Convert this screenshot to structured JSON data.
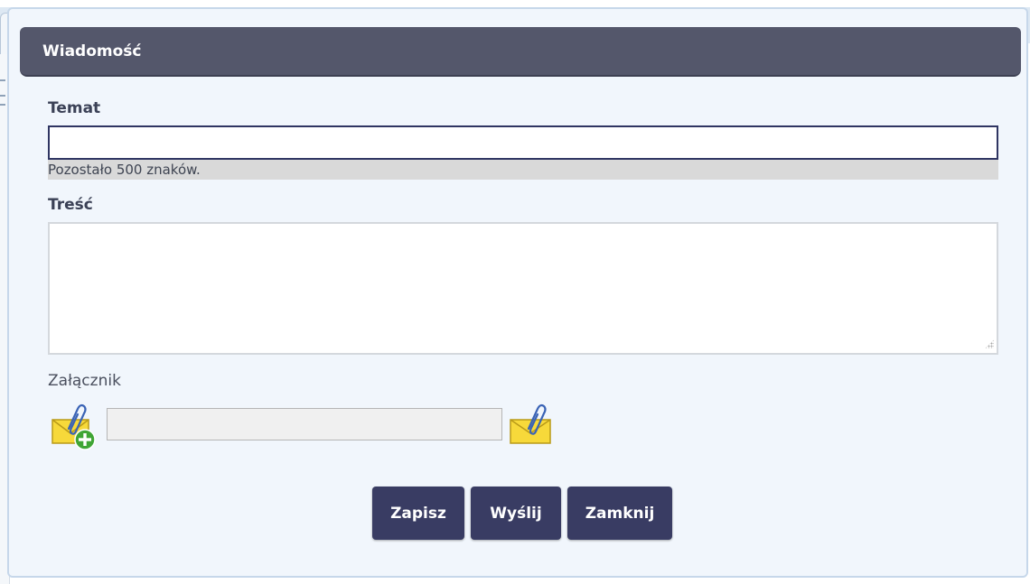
{
  "dialog": {
    "title": "Wiadomość"
  },
  "form": {
    "subject_label": "Temat",
    "subject_value": "",
    "remaining_text": "Pozostało 500 znaków.",
    "content_label": "Treść",
    "content_value": "",
    "attachment_label": "Załącznik",
    "attachment_value": ""
  },
  "buttons": {
    "save": "Zapisz",
    "send": "Wyślij",
    "close": "Zamknij"
  },
  "icons": {
    "add_attachment": "envelope-paperclip-add-icon",
    "attachment": "envelope-paperclip-icon"
  },
  "colors": {
    "header": "#54576b",
    "button": "#393c63",
    "panel": "#f1f6fc"
  }
}
